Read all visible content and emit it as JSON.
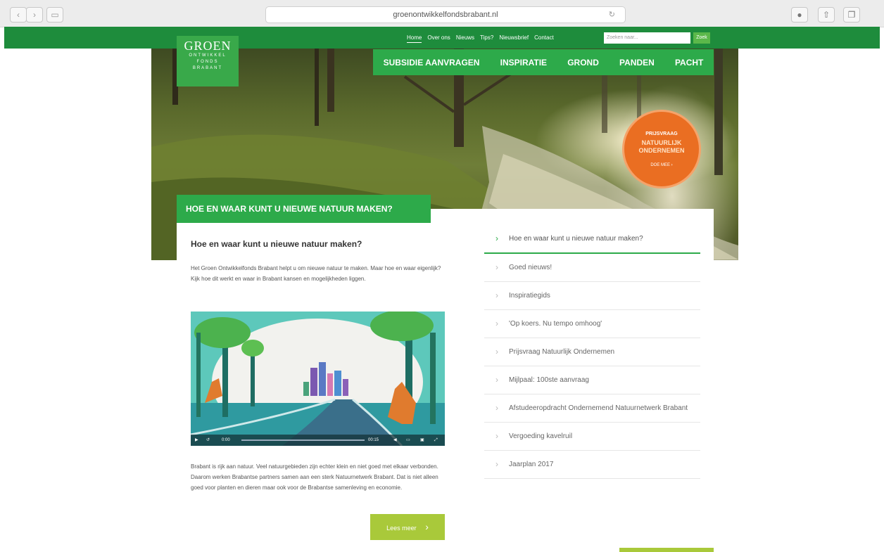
{
  "browser": {
    "url": "groenontwikkelfondsbrabant.nl"
  },
  "logo": {
    "line1": "GROEN",
    "line2": "ONTWIKKEL",
    "line3": "FONDS",
    "line4": "BRABANT"
  },
  "top_nav": [
    "Home",
    "Over ons",
    "Nieuws",
    "Tips?",
    "Nieuwsbrief",
    "Contact"
  ],
  "search": {
    "placeholder": "Zoeken naar...",
    "button": "Zoek"
  },
  "main_nav": [
    "SUBSIDIE AANVRAGEN",
    "INSPIRATIE",
    "GROND",
    "PANDEN",
    "PACHT"
  ],
  "badge": {
    "kicker": "PRIJSVRAAG",
    "title_line1": "NATUURLIJK",
    "title_line2": "ONDERNEMEN",
    "cta": "DOE MEE ›"
  },
  "page": {
    "banner": "HOE EN WAAR KUNT U NIEUWE NATUUR MAKEN?",
    "heading": "Hoe en waar kunt u nieuwe natuur maken?",
    "intro": "Het Groen Ontwikkelfonds Brabant helpt u om nieuwe natuur te maken. Maar hoe en waar eigenlijk? Kijk hoe dit werkt en waar in Brabant kansen en mogelijkheden liggen.",
    "body": "Brabant is rijk aan natuur. Veel natuurgebieden zijn echter klein en niet goed met elkaar verbonden. Daarom werken Brabantse partners samen aan een sterk Natuurnetwerk Brabant. Dat is niet alleen goed voor planten en dieren maar ook voor de Brabantse samenleving en economie.",
    "read_more": "Lees meer"
  },
  "video": {
    "current_time": "0:00",
    "duration": "00:15"
  },
  "sidebar_links": [
    "Hoe en waar kunt u nieuwe natuur maken?",
    "Goed nieuws!",
    "Inspiratiegids",
    "'Op koers. Nu tempo omhoog'",
    "Prijsvraag Natuurlijk Ondernemen",
    "Mijlpaal: 100ste aanvraag",
    "Afstudeeropdracht Ondernemend Natuurnetwerk Brabant",
    "Vergoeding kavelruil",
    "Jaarplan 2017"
  ],
  "colors": {
    "brand_green": "#2daa4a",
    "dark_green": "#1e8c3c",
    "lime": "#a9c93a",
    "orange": "#ea6e22"
  }
}
